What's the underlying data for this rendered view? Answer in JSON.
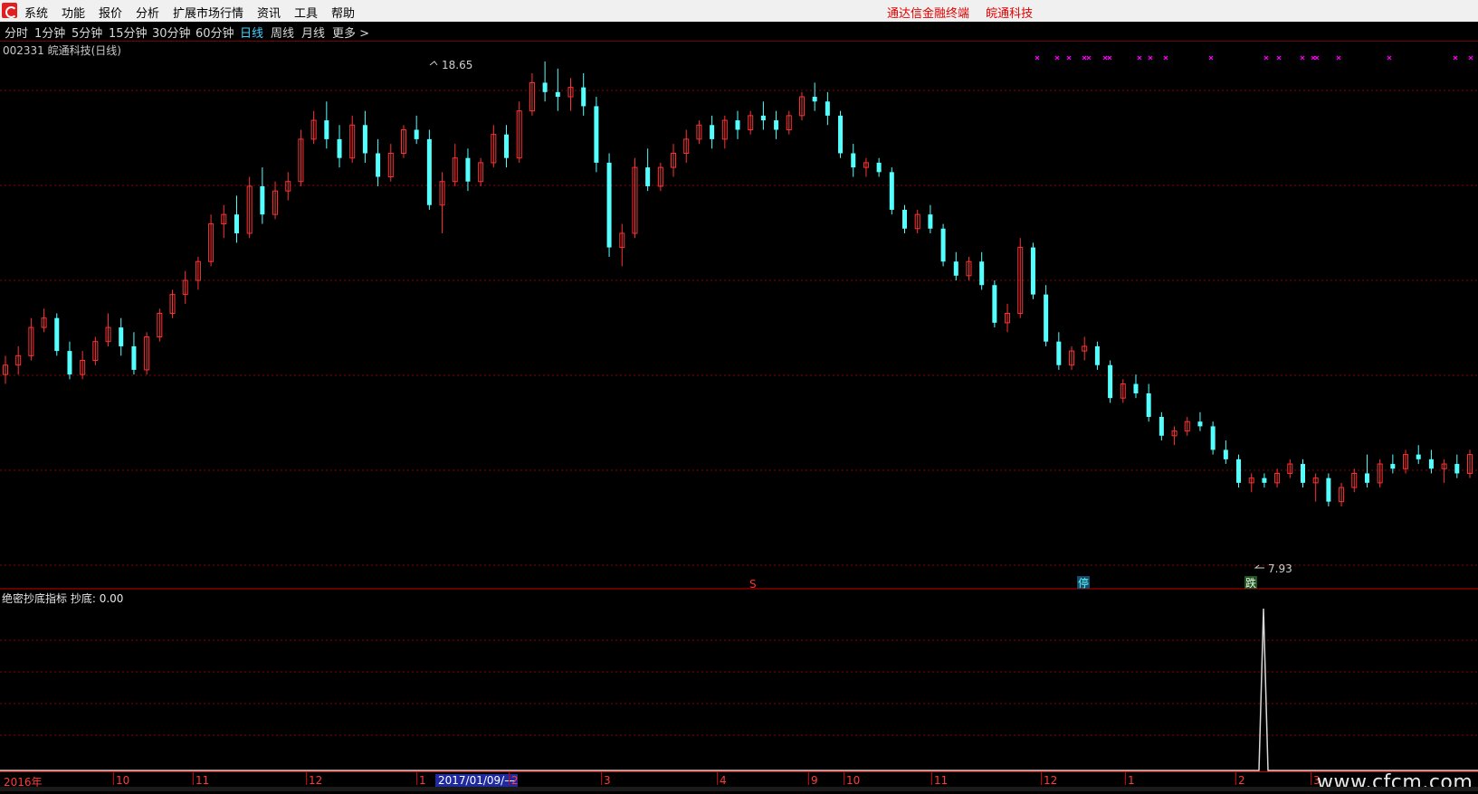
{
  "menu": {
    "items": [
      "系统",
      "功能",
      "报价",
      "分析",
      "扩展市场行情",
      "资讯",
      "工具",
      "帮助"
    ],
    "brand": "通达信金融终端",
    "stock_name": "皖通科技"
  },
  "periods": {
    "items": [
      "分时",
      "1分钟",
      "5分钟",
      "15分钟",
      "30分钟",
      "60分钟",
      "日线",
      "周线",
      "月线",
      "更多 >"
    ],
    "active": "日线"
  },
  "main_chart": {
    "header": "002331 皖通科技(日线)",
    "high_label": "18.65",
    "low_label": "7.93"
  },
  "signals": {
    "s_label": "S",
    "stop_label": "停",
    "fall_label": "跌"
  },
  "indicator": {
    "name": "绝密抄底指标",
    "field_label": "抄底:",
    "field_value": "0.00"
  },
  "timeline": {
    "labels": [
      "2016年",
      "10",
      "11",
      "12",
      "1",
      "2",
      "3",
      "4",
      "9",
      "10",
      "11",
      "12",
      "1",
      "2",
      "3"
    ],
    "cursor_date": "2017/01/09/—"
  },
  "watermark": "www.cfcm.com",
  "colors": {
    "up": "#ff3232",
    "down": "#54ffff",
    "grid": "#8b0000",
    "signal_x": "#ff00ff"
  },
  "chart_data": {
    "type": "candlestick",
    "symbol": "002331",
    "name": "皖通科技",
    "period": "日线",
    "annotations": [
      {
        "label": "18.65",
        "kind": "high",
        "value": 18.65
      },
      {
        "label": "7.93",
        "kind": "low",
        "value": 7.93
      }
    ],
    "ohlc_points": [
      [
        12.0,
        12.4,
        11.8,
        12.2
      ],
      [
        12.2,
        12.6,
        12.0,
        12.4
      ],
      [
        12.4,
        13.2,
        12.3,
        13.0
      ],
      [
        13.0,
        13.4,
        12.9,
        13.2
      ],
      [
        13.2,
        13.3,
        12.4,
        12.5
      ],
      [
        12.5,
        12.7,
        11.9,
        12.0
      ],
      [
        12.0,
        12.5,
        11.9,
        12.3
      ],
      [
        12.3,
        12.8,
        12.2,
        12.7
      ],
      [
        12.7,
        13.3,
        12.6,
        13.0
      ],
      [
        13.0,
        13.2,
        12.4,
        12.6
      ],
      [
        12.6,
        12.9,
        12.0,
        12.1
      ],
      [
        12.1,
        12.9,
        12.0,
        12.8
      ],
      [
        12.8,
        13.4,
        12.7,
        13.3
      ],
      [
        13.3,
        13.8,
        13.2,
        13.7
      ],
      [
        13.7,
        14.2,
        13.5,
        14.0
      ],
      [
        14.0,
        14.5,
        13.8,
        14.4
      ],
      [
        14.4,
        15.4,
        14.3,
        15.2
      ],
      [
        15.2,
        15.6,
        14.9,
        15.4
      ],
      [
        15.4,
        15.8,
        14.8,
        15.0
      ],
      [
        15.0,
        16.2,
        14.9,
        16.0
      ],
      [
        16.0,
        16.4,
        15.2,
        15.4
      ],
      [
        15.4,
        16.1,
        15.3,
        15.9
      ],
      [
        15.9,
        16.3,
        15.7,
        16.1
      ],
      [
        16.1,
        17.2,
        16.0,
        17.0
      ],
      [
        17.0,
        17.6,
        16.9,
        17.4
      ],
      [
        17.4,
        17.8,
        16.8,
        17.0
      ],
      [
        17.0,
        17.3,
        16.4,
        16.6
      ],
      [
        16.6,
        17.5,
        16.5,
        17.3
      ],
      [
        17.3,
        17.6,
        16.5,
        16.7
      ],
      [
        16.7,
        17.0,
        16.0,
        16.2
      ],
      [
        16.2,
        16.9,
        16.1,
        16.7
      ],
      [
        16.7,
        17.3,
        16.6,
        17.2
      ],
      [
        17.2,
        17.5,
        16.9,
        17.0
      ],
      [
        17.0,
        17.2,
        15.5,
        15.6
      ],
      [
        15.6,
        16.3,
        15.0,
        16.1
      ],
      [
        16.1,
        16.9,
        16.0,
        16.6
      ],
      [
        16.6,
        16.8,
        15.9,
        16.1
      ],
      [
        16.1,
        16.6,
        16.0,
        16.5
      ],
      [
        16.5,
        17.3,
        16.4,
        17.1
      ],
      [
        17.1,
        17.3,
        16.4,
        16.6
      ],
      [
        16.6,
        17.8,
        16.5,
        17.6
      ],
      [
        17.6,
        18.4,
        17.5,
        18.2
      ],
      [
        18.2,
        18.65,
        17.8,
        18.0
      ],
      [
        18.0,
        18.5,
        17.6,
        17.9
      ],
      [
        17.9,
        18.3,
        17.6,
        18.1
      ],
      [
        18.1,
        18.4,
        17.5,
        17.7
      ],
      [
        17.7,
        17.9,
        16.3,
        16.5
      ],
      [
        16.5,
        16.7,
        14.5,
        14.7
      ],
      [
        14.7,
        15.2,
        14.3,
        15.0
      ],
      [
        15.0,
        16.6,
        14.9,
        16.4
      ],
      [
        16.4,
        16.8,
        15.9,
        16.0
      ],
      [
        16.0,
        16.5,
        15.9,
        16.4
      ],
      [
        16.4,
        16.9,
        16.2,
        16.7
      ],
      [
        16.7,
        17.2,
        16.5,
        17.0
      ],
      [
        17.0,
        17.4,
        16.9,
        17.3
      ],
      [
        17.3,
        17.5,
        16.8,
        17.0
      ],
      [
        17.0,
        17.5,
        16.8,
        17.4
      ],
      [
        17.4,
        17.6,
        17.0,
        17.2
      ],
      [
        17.2,
        17.6,
        17.1,
        17.5
      ],
      [
        17.5,
        17.8,
        17.2,
        17.4
      ],
      [
        17.4,
        17.6,
        17.0,
        17.2
      ],
      [
        17.2,
        17.6,
        17.1,
        17.5
      ],
      [
        17.5,
        18.0,
        17.4,
        17.9
      ],
      [
        17.9,
        18.2,
        17.6,
        17.8
      ],
      [
        17.8,
        18.0,
        17.3,
        17.5
      ],
      [
        17.5,
        17.6,
        16.6,
        16.7
      ],
      [
        16.7,
        16.9,
        16.2,
        16.4
      ],
      [
        16.4,
        16.6,
        16.2,
        16.5
      ],
      [
        16.5,
        16.6,
        16.2,
        16.3
      ],
      [
        16.3,
        16.4,
        15.4,
        15.5
      ],
      [
        15.5,
        15.6,
        15.0,
        15.1
      ],
      [
        15.1,
        15.5,
        15.0,
        15.4
      ],
      [
        15.4,
        15.6,
        15.0,
        15.1
      ],
      [
        15.1,
        15.2,
        14.3,
        14.4
      ],
      [
        14.4,
        14.6,
        14.0,
        14.1
      ],
      [
        14.1,
        14.5,
        14.0,
        14.4
      ],
      [
        14.4,
        14.6,
        13.8,
        13.9
      ],
      [
        13.9,
        14.0,
        13.0,
        13.1
      ],
      [
        13.1,
        13.5,
        12.9,
        13.3
      ],
      [
        13.3,
        14.9,
        13.2,
        14.7
      ],
      [
        14.7,
        14.8,
        13.6,
        13.7
      ],
      [
        13.7,
        13.9,
        12.6,
        12.7
      ],
      [
        12.7,
        12.9,
        12.1,
        12.2
      ],
      [
        12.2,
        12.6,
        12.1,
        12.5
      ],
      [
        12.5,
        12.8,
        12.3,
        12.6
      ],
      [
        12.6,
        12.7,
        12.1,
        12.2
      ],
      [
        12.2,
        12.3,
        11.4,
        11.5
      ],
      [
        11.5,
        11.9,
        11.4,
        11.8
      ],
      [
        11.8,
        12.0,
        11.5,
        11.6
      ],
      [
        11.6,
        11.8,
        11.0,
        11.1
      ],
      [
        11.1,
        11.2,
        10.6,
        10.7
      ],
      [
        10.7,
        10.9,
        10.5,
        10.8
      ],
      [
        10.8,
        11.1,
        10.7,
        11.0
      ],
      [
        11.0,
        11.2,
        10.8,
        10.9
      ],
      [
        10.9,
        11.0,
        10.3,
        10.4
      ],
      [
        10.4,
        10.6,
        10.1,
        10.2
      ],
      [
        10.2,
        10.3,
        9.6,
        9.7
      ],
      [
        9.7,
        9.9,
        9.5,
        9.8
      ],
      [
        9.8,
        9.9,
        9.6,
        9.7
      ],
      [
        9.7,
        10.0,
        9.6,
        9.9
      ],
      [
        9.9,
        10.2,
        9.8,
        10.1
      ],
      [
        10.1,
        10.2,
        9.6,
        9.7
      ],
      [
        9.7,
        9.9,
        9.3,
        9.8
      ],
      [
        9.8,
        9.9,
        9.2,
        9.3
      ],
      [
        9.3,
        9.7,
        9.2,
        9.6
      ],
      [
        9.6,
        10.0,
        9.5,
        9.9
      ],
      [
        9.9,
        10.3,
        9.6,
        9.7
      ],
      [
        9.7,
        10.2,
        9.6,
        10.1
      ],
      [
        10.1,
        10.3,
        9.9,
        10.0
      ],
      [
        10.0,
        10.4,
        9.9,
        10.3
      ],
      [
        10.3,
        10.5,
        10.1,
        10.2
      ],
      [
        10.2,
        10.4,
        9.9,
        10.0
      ],
      [
        10.0,
        10.2,
        9.7,
        10.1
      ],
      [
        10.1,
        10.3,
        9.8,
        9.9
      ],
      [
        9.9,
        10.4,
        9.8,
        10.3
      ]
    ]
  }
}
